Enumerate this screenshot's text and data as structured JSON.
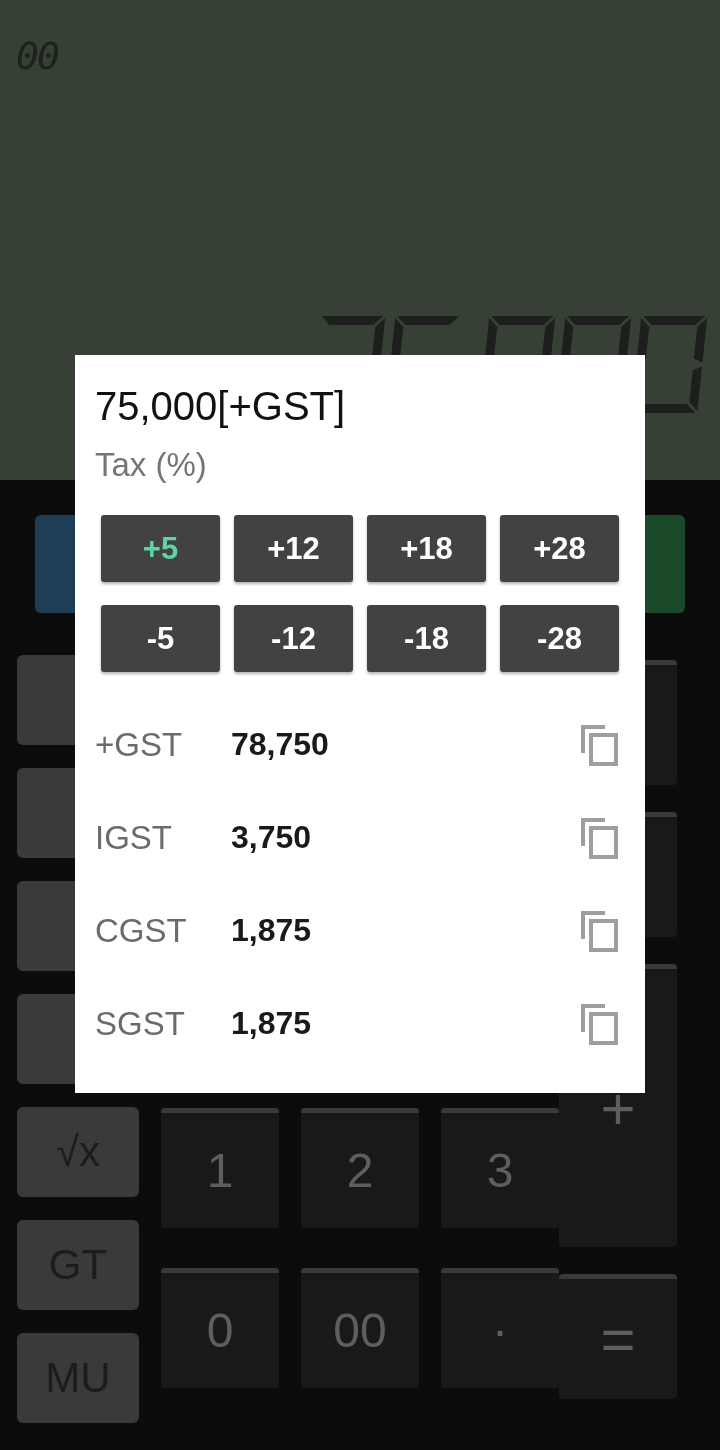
{
  "display": {
    "memory_indicator": "00"
  },
  "keypad": {
    "top_keys": [
      {
        "kind": "clear"
      },
      {
        "kind": "accent"
      }
    ],
    "function_keys": [
      {
        "kind": "blank"
      },
      {
        "kind": "blank"
      },
      {
        "kind": "blank"
      },
      {
        "kind": "blank"
      },
      {
        "kind": "labeled",
        "label": "√x"
      },
      {
        "kind": "labeled",
        "label": "GT"
      },
      {
        "kind": "labeled",
        "label": "MU"
      }
    ],
    "number_keys": [
      [
        "1",
        "2",
        "3"
      ],
      [
        "0",
        "00",
        "·"
      ]
    ],
    "operator_keys": [
      {
        "kind": "blank"
      },
      {
        "kind": "blank"
      },
      {
        "kind": "tall",
        "label": "+"
      },
      {
        "kind": "normal",
        "label": "="
      }
    ]
  },
  "dialog": {
    "title": "75,000[+GST]",
    "subtitle": "Tax (%)",
    "tax_buttons": [
      {
        "label": "+5",
        "selected": true
      },
      {
        "label": "+12",
        "selected": false
      },
      {
        "label": "+18",
        "selected": false
      },
      {
        "label": "+28",
        "selected": false
      },
      {
        "label": "-5",
        "selected": false
      },
      {
        "label": "-12",
        "selected": false
      },
      {
        "label": "-18",
        "selected": false
      },
      {
        "label": "-28",
        "selected": false
      }
    ],
    "results": [
      {
        "label": "+GST",
        "value": "78,750"
      },
      {
        "label": "IGST",
        "value": "3,750"
      },
      {
        "label": "CGST",
        "value": "1,875"
      },
      {
        "label": "SGST",
        "value": "1,875"
      }
    ]
  }
}
